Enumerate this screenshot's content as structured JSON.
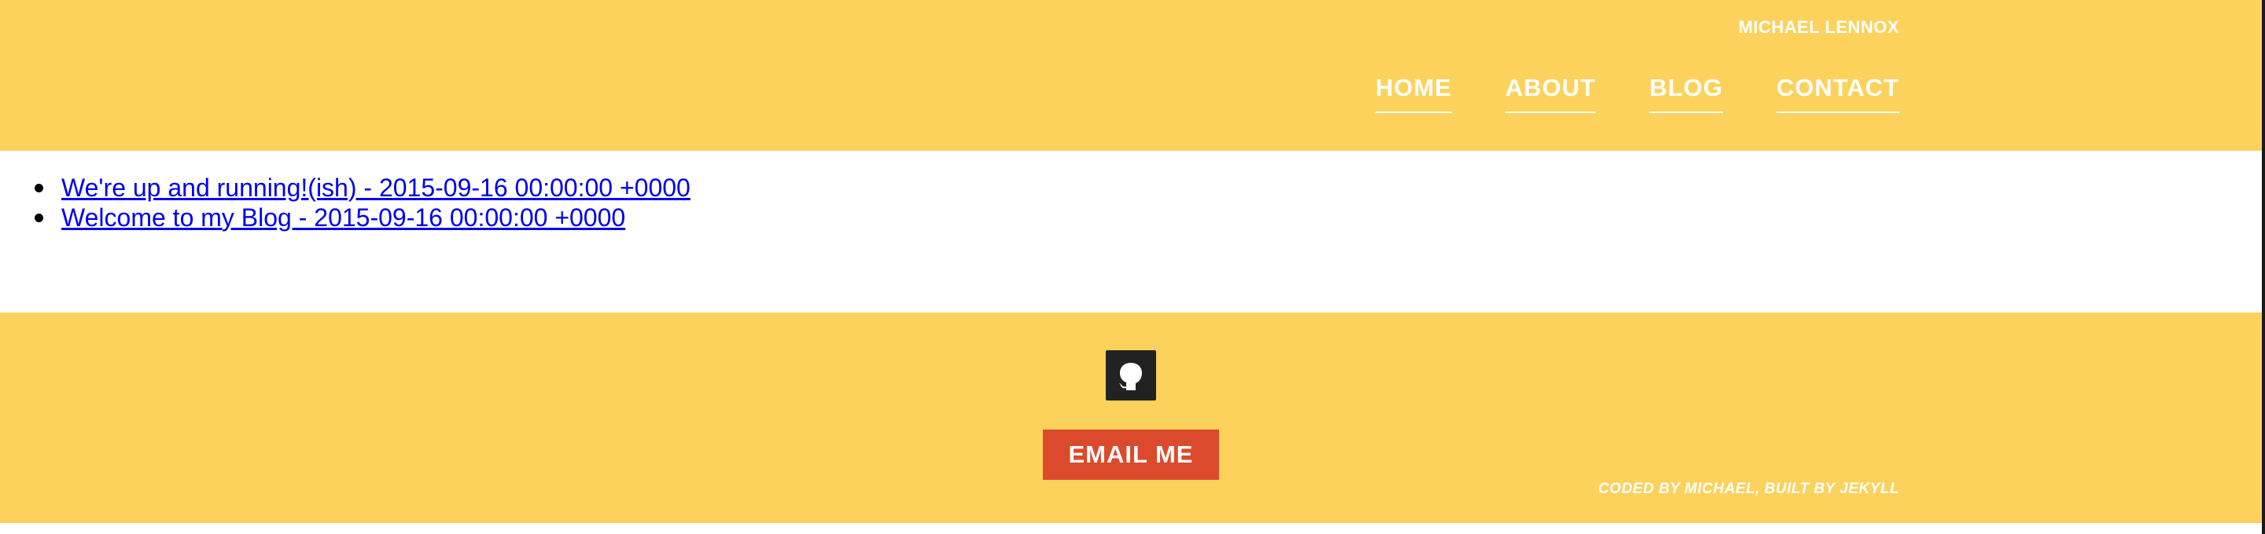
{
  "header": {
    "site_name": "MICHAEL LENNOX",
    "nav": [
      {
        "label": "HOME"
      },
      {
        "label": "ABOUT"
      },
      {
        "label": "BLOG"
      },
      {
        "label": "CONTACT"
      }
    ]
  },
  "posts": [
    {
      "title": "We're up and running!(ish) - 2015-09-16 00:00:00 +0000"
    },
    {
      "title": "Welcome to my Blog - 2015-09-16 00:00:00 +0000"
    }
  ],
  "footer": {
    "github_icon": "github-octocat-icon",
    "email_label": "EMAIL ME",
    "credits": "CODED BY MICHAEL, BUILT BY JEKYLL"
  },
  "colors": {
    "accent_yellow": "#fdd25c",
    "email_red": "#db4a2c",
    "link_blue": "#0000ee",
    "icon_dark": "#222222"
  }
}
